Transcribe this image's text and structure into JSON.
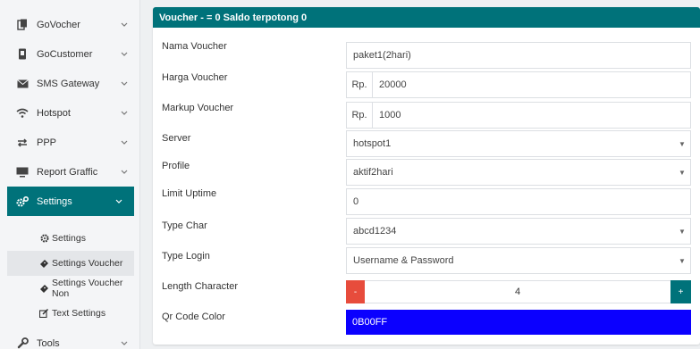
{
  "sidebar": {
    "items": [
      {
        "label": "GoVocher",
        "icon": "file-icon"
      },
      {
        "label": "GoCustomer",
        "icon": "mobile-icon"
      },
      {
        "label": "SMS Gateway",
        "icon": "envelope-icon"
      },
      {
        "label": "Hotspot",
        "icon": "wifi-icon"
      },
      {
        "label": "PPP",
        "icon": "exchange-icon"
      },
      {
        "label": "Report Graffic",
        "icon": "monitor-icon"
      },
      {
        "label": "Settings",
        "icon": "cogs-icon"
      },
      {
        "label": "Tools",
        "icon": "wrench-icon"
      }
    ],
    "submenu": [
      {
        "label": "Settings",
        "icon": "gear-icon"
      },
      {
        "label": "Settings Voucher",
        "icon": "ticket-icon"
      },
      {
        "label": "Settings Voucher Non",
        "icon": "ticket-icon"
      },
      {
        "label": "Text Settings",
        "icon": "edit-icon"
      }
    ]
  },
  "panel": {
    "title": "Voucher - = 0 Saldo terpotong 0",
    "header_color": "#00727a",
    "fields": {
      "nama_voucher": {
        "label": "Nama Voucher",
        "value": "paket1(2hari)"
      },
      "harga_voucher": {
        "label": "Harga Voucher",
        "prefix": "Rp.",
        "value": "20000"
      },
      "markup_voucher": {
        "label": "Markup Voucher",
        "prefix": "Rp.",
        "value": "1000"
      },
      "server": {
        "label": "Server",
        "value": "hotspot1"
      },
      "profile": {
        "label": "Profile",
        "value": "aktif2hari"
      },
      "limit_uptime": {
        "label": "Limit Uptime",
        "value": "0"
      },
      "type_char": {
        "label": "Type Char",
        "value": "abcd1234"
      },
      "type_login": {
        "label": "Type Login",
        "value": "Username & Password"
      },
      "length_character": {
        "label": "Length Character",
        "minus": "-",
        "value": "4",
        "plus": "+"
      },
      "qr_code_color": {
        "label": "Qr Code Color",
        "value": "0B00FF",
        "swatch": "#0B00FF"
      }
    }
  }
}
